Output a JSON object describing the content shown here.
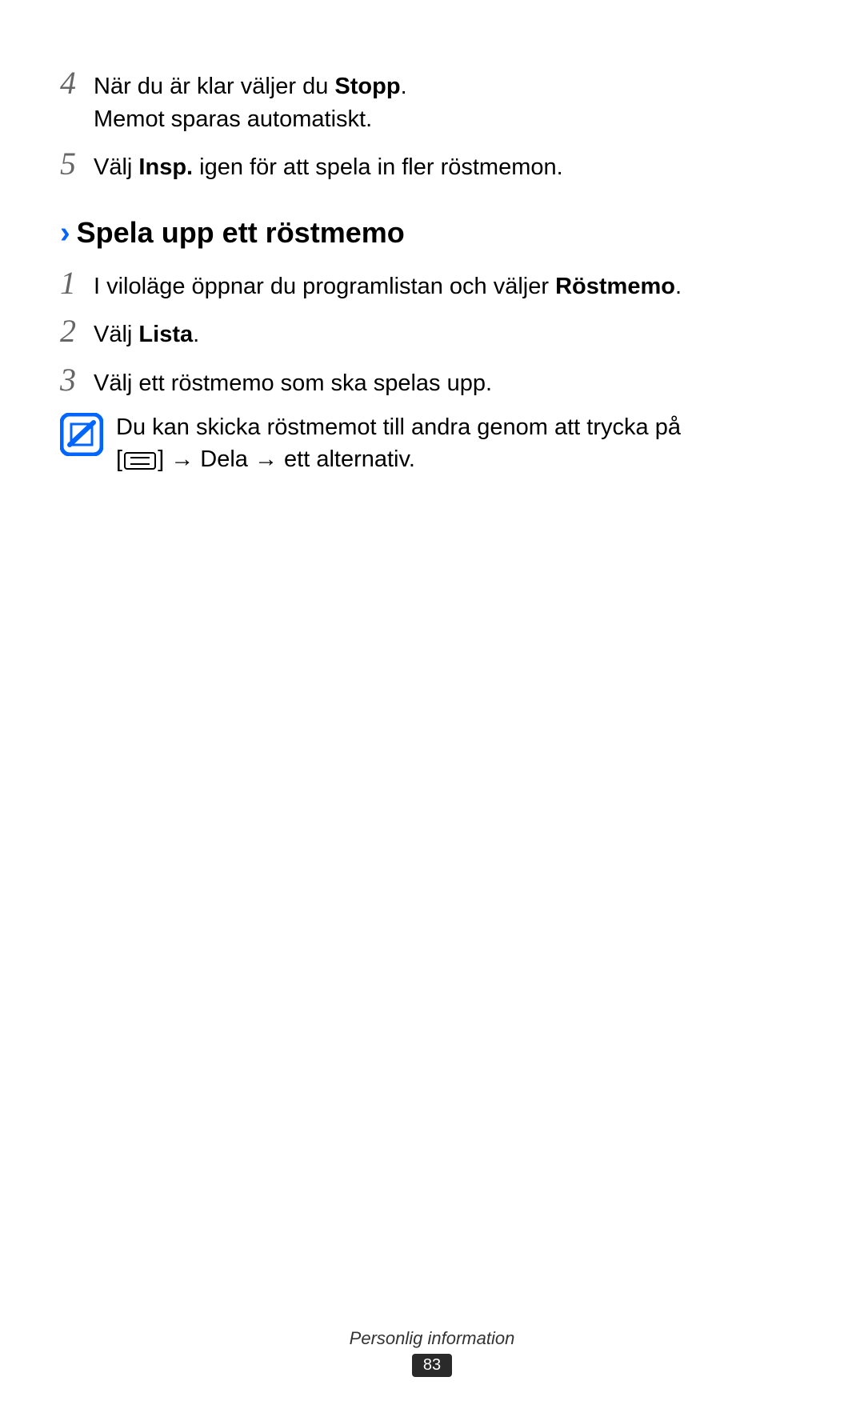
{
  "steps_top": [
    {
      "num": "4",
      "parts": [
        {
          "t": "När du är klar väljer du ",
          "b": false
        },
        {
          "t": "Stopp",
          "b": true
        },
        {
          "t": ".",
          "b": false
        }
      ],
      "line2": "Memot sparas automatiskt."
    },
    {
      "num": "5",
      "parts": [
        {
          "t": "Välj ",
          "b": false
        },
        {
          "t": "Insp.",
          "b": true
        },
        {
          "t": " igen för att spela in fler röstmemon.",
          "b": false
        }
      ]
    }
  ],
  "section": {
    "heading": "Spela upp ett röstmemo"
  },
  "steps_section": [
    {
      "num": "1",
      "parts": [
        {
          "t": "I viloläge öppnar du programlistan och väljer ",
          "b": false
        },
        {
          "t": "Röstmemo",
          "b": true
        },
        {
          "t": ".",
          "b": false
        }
      ]
    },
    {
      "num": "2",
      "parts": [
        {
          "t": "Välj ",
          "b": false
        },
        {
          "t": "Lista",
          "b": true
        },
        {
          "t": ".",
          "b": false
        }
      ]
    },
    {
      "num": "3",
      "parts": [
        {
          "t": "Välj ett röstmemo som ska spelas upp.",
          "b": false
        }
      ]
    }
  ],
  "note": {
    "line1": "Du kan skicka röstmemot till andra genom att trycka på",
    "prefix": "[",
    "arrow1": " → ",
    "bold": "Dela",
    "arrow2": " → ",
    "suffix": "ett alternativ.",
    "bracket_close": "] "
  },
  "footer": {
    "label": "Personlig information",
    "page": "83"
  }
}
